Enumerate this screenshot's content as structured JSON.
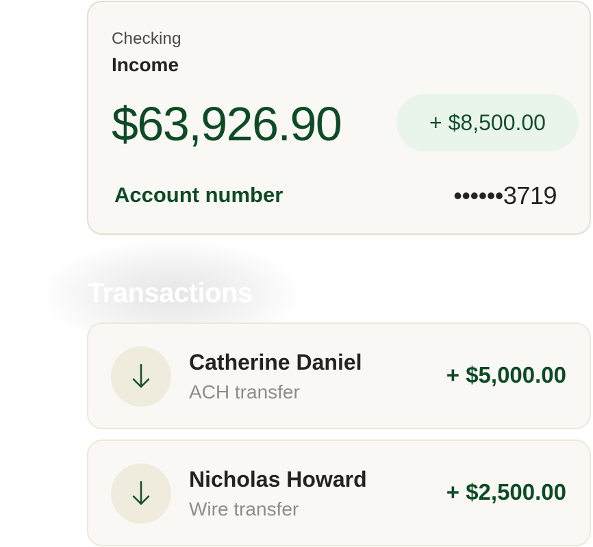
{
  "account": {
    "type": "Checking",
    "name": "Income",
    "balance": "$63,926.90",
    "recent_change": "+ $8,500.00",
    "number_label": "Account number",
    "number_masked": "••••••3719"
  },
  "transactions": {
    "heading": "Transactions",
    "items": [
      {
        "name": "Catherine Daniel",
        "method": "ACH transfer",
        "amount": "+ $5,000.00",
        "icon": "arrow-down-icon"
      },
      {
        "name": "Nicholas Howard",
        "method": "Wire transfer",
        "amount": "+ $2,500.00",
        "icon": "arrow-down-icon"
      }
    ]
  },
  "colors": {
    "brand_green": "#0d4b26",
    "card_bg": "#faf8f4",
    "pill_bg": "#e9f5ea",
    "icon_circle_bg": "#efebdd",
    "muted_text": "#8f8c88"
  }
}
